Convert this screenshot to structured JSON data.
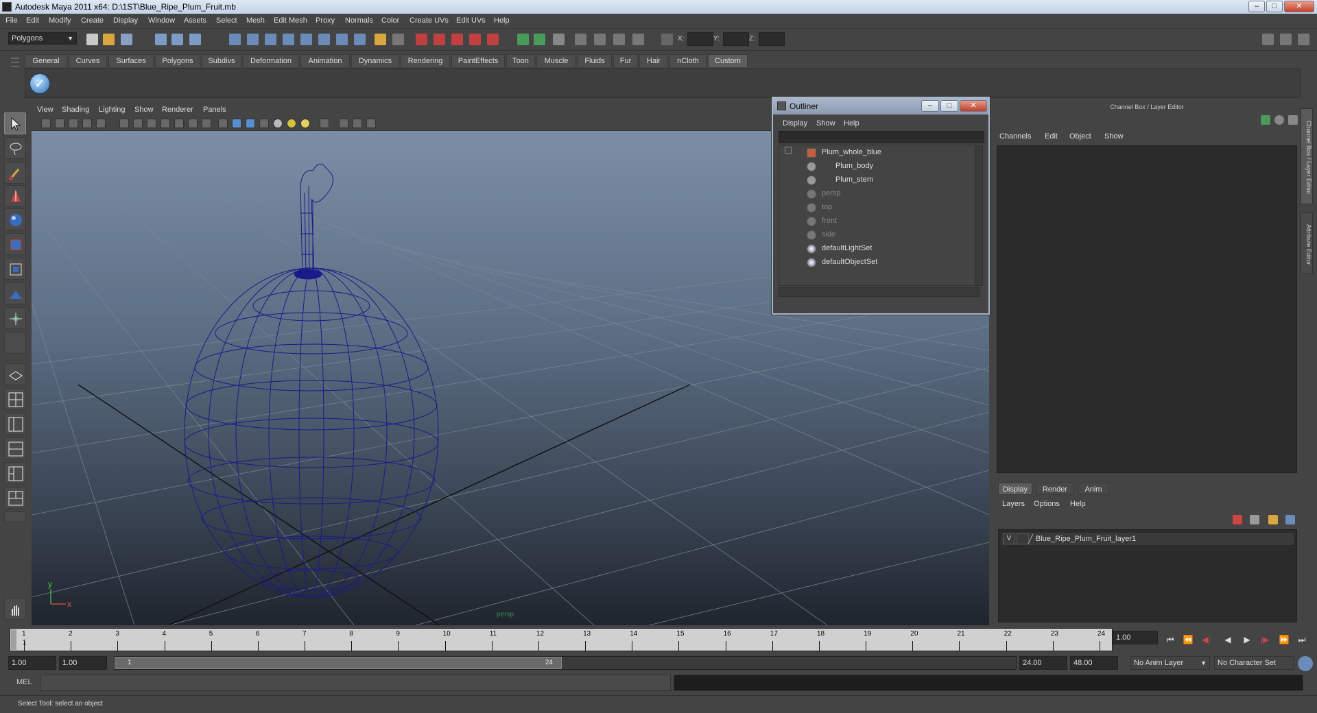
{
  "window": {
    "title": "Autodesk Maya 2011 x64: D:\\1ST\\Blue_Ripe_Plum_Fruit.mb",
    "minimize": "–",
    "maximize": "□",
    "close": "✕"
  },
  "menubar": [
    "File",
    "Edit",
    "Modify",
    "Create",
    "Display",
    "Window",
    "Assets",
    "Select",
    "Mesh",
    "Edit Mesh",
    "Proxy",
    "Normals",
    "Color",
    "Create UVs",
    "Edit UVs",
    "Help"
  ],
  "statusline": {
    "mode": "Polygons",
    "x_label": "X:",
    "y_label": "Y:",
    "z_label": "Z:"
  },
  "shelf": {
    "tabs": [
      "General",
      "Curves",
      "Surfaces",
      "Polygons",
      "Subdivs",
      "Deformation",
      "Animation",
      "Dynamics",
      "Rendering",
      "PaintEffects",
      "Toon",
      "Muscle",
      "Fluids",
      "Fur",
      "Hair",
      "nCloth",
      "Custom"
    ],
    "active_tab": "Custom"
  },
  "panel": {
    "menus": [
      "View",
      "Shading",
      "Lighting",
      "Show",
      "Renderer",
      "Panels"
    ],
    "camera_label": "persp",
    "axis_x": "x",
    "axis_y": "y"
  },
  "outliner": {
    "title": "Outliner",
    "menus": [
      "Display",
      "Show",
      "Help"
    ],
    "items": [
      {
        "name": "Plum_whole_blue",
        "dim": false,
        "indent": 1
      },
      {
        "name": "Plum_body",
        "dim": false,
        "indent": 2
      },
      {
        "name": "Plum_stem",
        "dim": false,
        "indent": 2
      },
      {
        "name": "persp",
        "dim": true,
        "indent": 1
      },
      {
        "name": "top",
        "dim": true,
        "indent": 1
      },
      {
        "name": "front",
        "dim": true,
        "indent": 1
      },
      {
        "name": "side",
        "dim": true,
        "indent": 1
      },
      {
        "name": "defaultLightSet",
        "dim": false,
        "indent": 1
      },
      {
        "name": "defaultObjectSet",
        "dim": false,
        "indent": 1
      }
    ]
  },
  "channelbox": {
    "title": "Channel Box / Layer Editor",
    "menus": [
      "Channels",
      "Edit",
      "Object",
      "Show"
    ],
    "side_tabs": [
      "Channel Box / Layer Editor",
      "Attribute Editor"
    ]
  },
  "layer_editor": {
    "tabs": [
      "Display",
      "Render",
      "Anim"
    ],
    "active_tab": "Display",
    "menus": [
      "Layers",
      "Options",
      "Help"
    ],
    "layer": {
      "visible": "V",
      "name": "Blue_Ripe_Plum_Fruit_layer1"
    }
  },
  "time": {
    "tick_labels": [
      "1",
      "2",
      "3",
      "4",
      "5",
      "6",
      "7",
      "8",
      "9",
      "10",
      "11",
      "12",
      "13",
      "14",
      "15",
      "16",
      "17",
      "18",
      "19",
      "20",
      "21",
      "22",
      "23",
      "24"
    ],
    "current_frame": "1",
    "current_time_field": "1.00",
    "range_start": "1.00",
    "range_start2": "1.00",
    "range_inner_start": "1",
    "range_inner_end": "24",
    "range_end": "24.00",
    "range_end2": "48.00",
    "anim_layer": "No Anim Layer",
    "char_set": "No Character Set"
  },
  "command": {
    "label": "MEL",
    "help": "Select Tool: select an object"
  }
}
